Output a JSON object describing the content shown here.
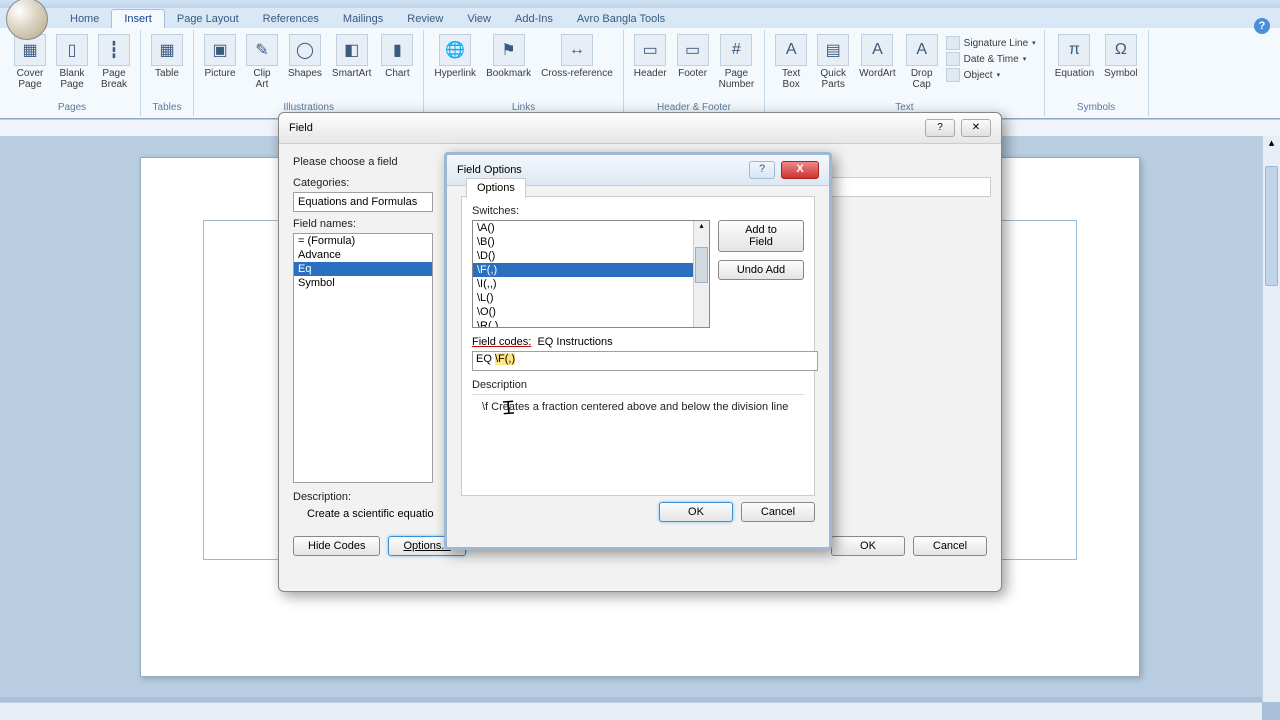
{
  "tabs": [
    "Home",
    "Insert",
    "Page Layout",
    "References",
    "Mailings",
    "Review",
    "View",
    "Add-Ins",
    "Avro Bangla Tools"
  ],
  "active_tab": "Insert",
  "ribbon": {
    "groups": [
      {
        "label": "Pages",
        "items": [
          {
            "name": "cover-page",
            "label": "Cover\nPage",
            "icon": "▦"
          },
          {
            "name": "blank-page",
            "label": "Blank\nPage",
            "icon": "▯"
          },
          {
            "name": "page-break",
            "label": "Page\nBreak",
            "icon": "┇"
          }
        ]
      },
      {
        "label": "Tables",
        "items": [
          {
            "name": "table",
            "label": "Table",
            "icon": "▦"
          }
        ]
      },
      {
        "label": "Illustrations",
        "items": [
          {
            "name": "picture",
            "label": "Picture",
            "icon": "▣"
          },
          {
            "name": "clip-art",
            "label": "Clip\nArt",
            "icon": "✎"
          },
          {
            "name": "shapes",
            "label": "Shapes",
            "icon": "◯"
          },
          {
            "name": "smartart",
            "label": "SmartArt",
            "icon": "◧"
          },
          {
            "name": "chart",
            "label": "Chart",
            "icon": "▮"
          }
        ]
      },
      {
        "label": "Links",
        "items": [
          {
            "name": "hyperlink",
            "label": "Hyperlink",
            "icon": "🌐"
          },
          {
            "name": "bookmark",
            "label": "Bookmark",
            "icon": "⚑"
          },
          {
            "name": "cross-reference",
            "label": "Cross-reference",
            "icon": "↔"
          }
        ]
      },
      {
        "label": "Header & Footer",
        "items": [
          {
            "name": "header",
            "label": "Header",
            "icon": "▭"
          },
          {
            "name": "footer",
            "label": "Footer",
            "icon": "▭"
          },
          {
            "name": "page-number",
            "label": "Page\nNumber",
            "icon": "#"
          }
        ]
      },
      {
        "label": "Text",
        "items": [
          {
            "name": "text-box",
            "label": "Text\nBox",
            "icon": "A"
          },
          {
            "name": "quick-parts",
            "label": "Quick\nParts",
            "icon": "▤"
          },
          {
            "name": "wordart",
            "label": "WordArt",
            "icon": "A"
          },
          {
            "name": "drop-cap",
            "label": "Drop\nCap",
            "icon": "A"
          }
        ],
        "side": [
          {
            "name": "signature-line",
            "label": "Signature Line"
          },
          {
            "name": "date-time",
            "label": "Date & Time"
          },
          {
            "name": "object",
            "label": "Object"
          }
        ]
      },
      {
        "label": "Symbols",
        "items": [
          {
            "name": "equation",
            "label": "Equation",
            "icon": "π"
          },
          {
            "name": "symbol",
            "label": "Symbol",
            "icon": "Ω"
          }
        ]
      }
    ]
  },
  "field_dialog": {
    "title": "Field",
    "choose_label": "Please choose a field",
    "categories_label": "Categories:",
    "category_value": "Equations and Formulas",
    "field_names_label": "Field names:",
    "field_names": [
      "= (Formula)",
      "Advance",
      "Eq",
      "Symbol"
    ],
    "selected_field": "Eq",
    "description_label": "Description:",
    "description_text": "Create a scientific equatio",
    "hide_codes": "Hide Codes",
    "options": "Options...",
    "ok": "OK",
    "cancel": "Cancel"
  },
  "field_options_dialog": {
    "title": "Field Options",
    "tab": "Options",
    "switches_label": "Switches:",
    "switches": [
      "\\A()",
      "\\B()",
      "\\D()",
      "\\F(,)",
      "\\I(,,)",
      "\\L()",
      "\\O()",
      "\\R(,)"
    ],
    "selected_switch": "\\F(,)",
    "add_to_field": "Add to Field",
    "undo_add": "Undo Add",
    "field_codes_label": "Field codes:",
    "field_codes_instr": "EQ Instructions",
    "field_codes_value_prefix": "EQ ",
    "field_codes_value_hl": "\\F(,)",
    "description_label": "Description",
    "description_text": "\\f Creates a fraction centered above and below the division line",
    "ok": "OK",
    "cancel": "Cancel"
  }
}
